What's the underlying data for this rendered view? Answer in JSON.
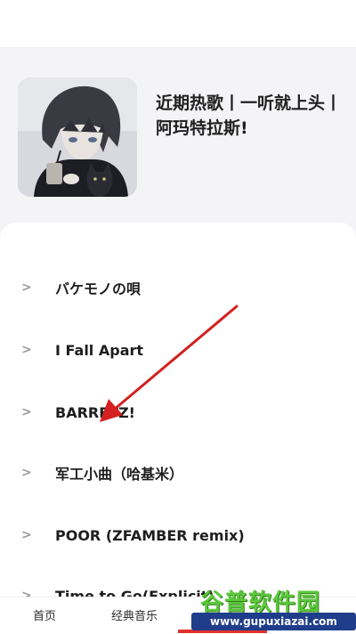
{
  "playlist": {
    "title": "近期热歌丨一听就上头丨阿玛特拉斯!",
    "cover_icon": "album-cover-image"
  },
  "songs": [
    {
      "arrow": ">",
      "name": "バケモノの唄"
    },
    {
      "arrow": ">",
      "name": "I Fall Apart"
    },
    {
      "arrow": ">",
      "name": "BARRETZ!"
    },
    {
      "arrow": ">",
      "name": "军工小曲（哈基米）"
    },
    {
      "arrow": ">",
      "name": "POOR (ZFAMBER remix)"
    },
    {
      "arrow": ">",
      "name": "Time to Go(Explicit)"
    }
  ],
  "nav": {
    "items": [
      "首页",
      "经典音乐",
      "",
      ""
    ],
    "active_index": 2,
    "active_color": "#e0312d"
  },
  "watermark": {
    "title": "谷普软件园",
    "url": "www.gupuxiazai.com"
  },
  "annotation": {
    "color": "#d42020",
    "icon": "red-arrow-pointer"
  }
}
